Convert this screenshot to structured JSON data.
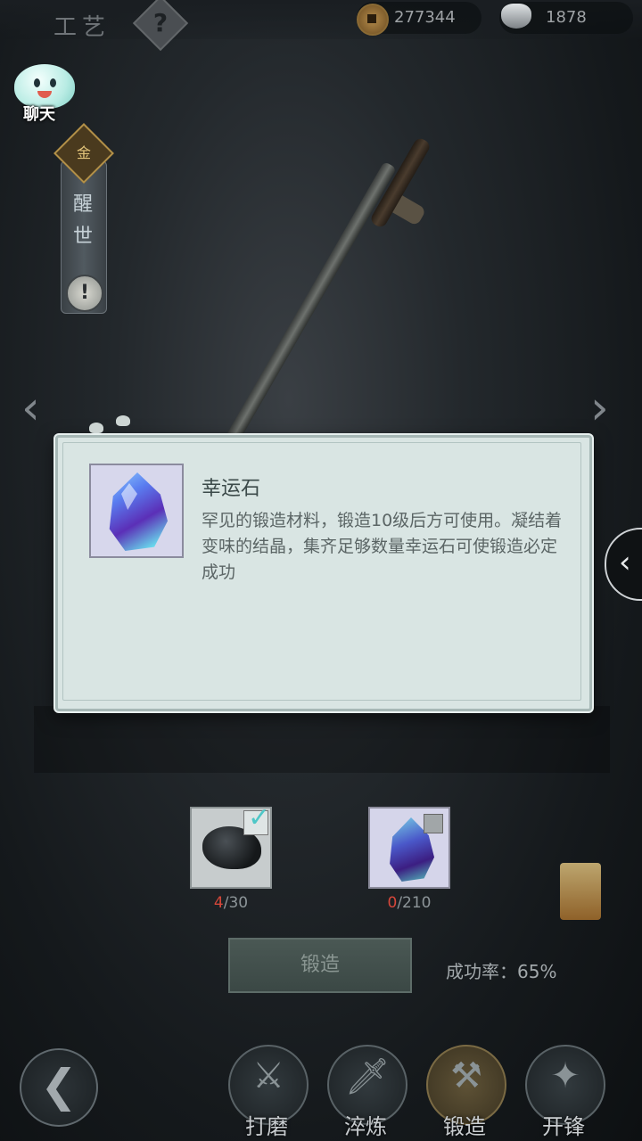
{
  "header": {
    "title": "工艺",
    "help_symbol": "?",
    "copper_coins": "277344",
    "silver": "1878"
  },
  "chat": {
    "label": "聊天"
  },
  "weapon_plate": {
    "grade_char": "金",
    "name_chars": [
      "醒",
      "世"
    ],
    "warning_symbol": "!"
  },
  "nav_arrows": {
    "left": "‹",
    "right": "›",
    "side": "‹"
  },
  "tooltip": {
    "item_name": "幸运石",
    "item_description": "罕见的锻造材料，锻造10级后方可使用。凝结着变味的结晶，集齐足够数量幸运石可使锻造必定成功"
  },
  "materials": [
    {
      "name": "ore",
      "have": "4",
      "need": "/30",
      "checked": true
    },
    {
      "name": "lucky-stone",
      "have": "0",
      "need": "/210",
      "checked": false
    }
  ],
  "forge": {
    "button_label": "锻造",
    "success_rate": "成功率：65%"
  },
  "bottom_nav": {
    "back_symbol": "❮",
    "tabs": [
      {
        "label": "打磨",
        "icon": "grind-icon"
      },
      {
        "label": "淬炼",
        "icon": "temper-icon"
      },
      {
        "label": "锻造",
        "icon": "hammer-icon",
        "active": true
      },
      {
        "label": "开锋",
        "icon": "sharpen-icon"
      }
    ]
  },
  "colors": {
    "accent_teal": "#4ec7c7",
    "warning_red": "#d6473a",
    "popup_bg": "#d9e5e3"
  }
}
